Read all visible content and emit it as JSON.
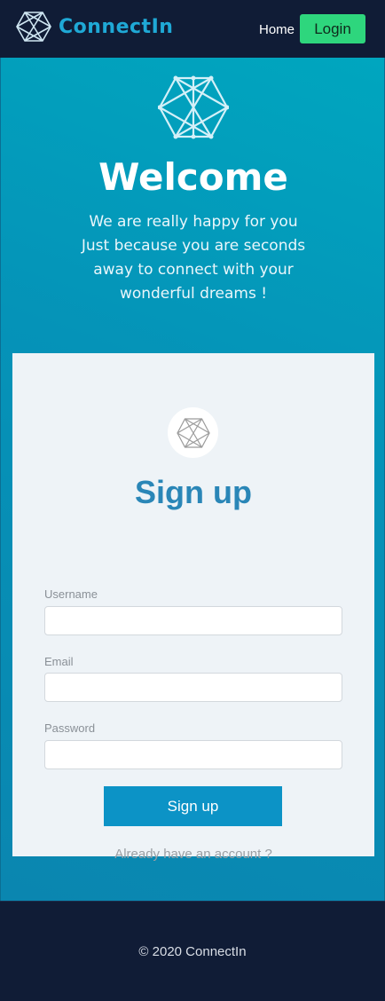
{
  "navbar": {
    "brand": "ConnectIn",
    "links": {
      "home": "Home",
      "login": "Login"
    },
    "icon": "hexagon-network-icon",
    "brand_color": "#1fa9d6",
    "login_color": "#2ed67d"
  },
  "hero": {
    "title": "Welcome",
    "lines": [
      "We are really happy for you",
      "Just because you are seconds",
      "away to connect with your",
      "wonderful dreams !"
    ],
    "icon": "hexagon-network-icon"
  },
  "signup": {
    "icon": "hexagon-network-icon",
    "title": "Sign up",
    "fields": [
      {
        "label": "Username",
        "value": "",
        "placeholder": ""
      },
      {
        "label": "Email",
        "value": "",
        "placeholder": ""
      },
      {
        "label": "Password",
        "value": "",
        "placeholder": ""
      }
    ],
    "submit_label": "Sign up",
    "already_link": "Already have an account ?",
    "accent_color": "#0c93c6"
  },
  "footer": {
    "text": "© 2020 ConnectIn"
  }
}
